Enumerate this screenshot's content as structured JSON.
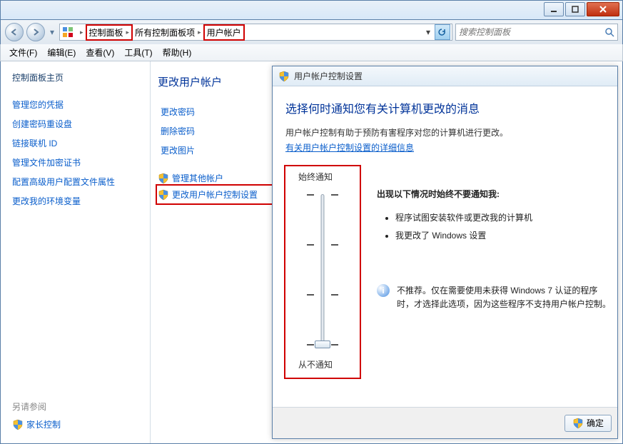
{
  "breadcrumb": {
    "root_icon": "control-panel-icon",
    "items": [
      "控制面板",
      "所有控制面板项",
      "用户帐户"
    ]
  },
  "search": {
    "placeholder": "搜索控制面板"
  },
  "menu": {
    "file": "文件(F)",
    "edit": "编辑(E)",
    "view": "查看(V)",
    "tools": "工具(T)",
    "help": "帮助(H)"
  },
  "sidebar": {
    "home": "控制面板主页",
    "links": [
      "管理您的凭据",
      "创建密码重设盘",
      "链接联机 ID",
      "管理文件加密证书",
      "配置高级用户配置文件属性",
      "更改我的环境变量"
    ],
    "see_also": "另请参阅",
    "parental": "家长控制"
  },
  "midpane": {
    "heading": "更改用户帐户",
    "actions": [
      "更改密码",
      "删除密码",
      "更改图片"
    ],
    "shield_actions": [
      "管理其他帐户",
      "更改用户帐户控制设置"
    ]
  },
  "uac": {
    "title": "用户帐户控制设置",
    "heading": "选择何时通知您有关计算机更改的消息",
    "desc": "用户帐户控制有助于预防有害程序对您的计算机进行更改。",
    "moreinfo": "有关用户帐户控制设置的详细信息",
    "slider": {
      "top": "始终通知",
      "bottom": "从不通知"
    },
    "message": {
      "heading": "出现以下情况时始终不要通知我:",
      "bullets": [
        "程序试图安装软件或更改我的计算机",
        "我更改了 Windows 设置"
      ]
    },
    "recommend": "不推荐。仅在需要使用未获得 Windows 7 认证的程序时，才选择此选项，因为这些程序不支持用户帐户控制。",
    "ok": "确定"
  }
}
